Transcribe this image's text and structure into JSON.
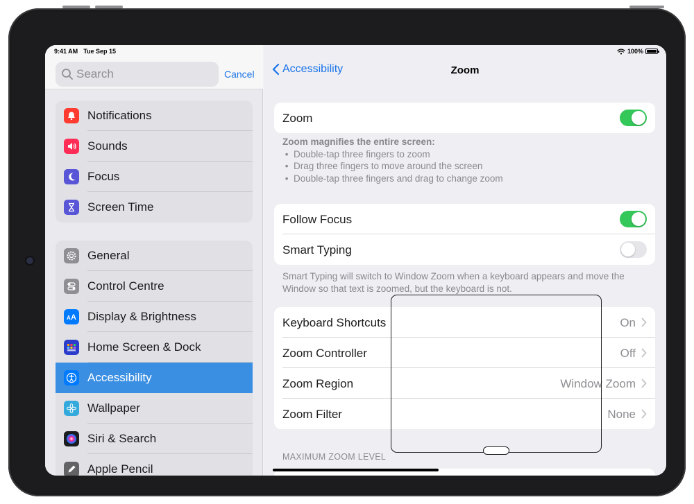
{
  "status": {
    "time": "9:41 AM",
    "date": "Tue Sep 15",
    "battery": "100%"
  },
  "search": {
    "placeholder": "Search",
    "cancel": "Cancel"
  },
  "sidebar": {
    "group1": [
      {
        "label": "Notifications",
        "icon": "bell-icon",
        "color": "#ff3b30"
      },
      {
        "label": "Sounds",
        "icon": "speaker-icon",
        "color": "#ff2d55"
      },
      {
        "label": "Focus",
        "icon": "moon-icon",
        "color": "#5856d6"
      },
      {
        "label": "Screen Time",
        "icon": "hourglass-icon",
        "color": "#5856d6"
      }
    ],
    "group2": [
      {
        "label": "General",
        "icon": "gear-icon",
        "color": "#8e8e93"
      },
      {
        "label": "Control Centre",
        "icon": "switches-icon",
        "color": "#8e8e93"
      },
      {
        "label": "Display & Brightness",
        "icon": "text-size-icon",
        "color": "#007aff"
      },
      {
        "label": "Home Screen & Dock",
        "icon": "app-grid-icon",
        "color": "#2c3dcc"
      },
      {
        "label": "Accessibility",
        "icon": "accessibility-icon",
        "color": "#007aff",
        "selected": true
      },
      {
        "label": "Wallpaper",
        "icon": "flower-icon",
        "color": "#34aadc"
      },
      {
        "label": "Siri & Search",
        "icon": "siri-icon",
        "color": "#1c1c1e"
      },
      {
        "label": "Apple Pencil",
        "icon": "pencil-icon",
        "color": "#636366"
      }
    ]
  },
  "nav": {
    "back_label": "Accessibility",
    "title": "Zoom"
  },
  "zoom": {
    "label": "Zoom",
    "enabled": true
  },
  "zoom_desc": {
    "heading": "Zoom magnifies the entire screen:",
    "lines": [
      "Double-tap three fingers to zoom",
      "Drag three fingers to move around the screen",
      "Double-tap three fingers and drag to change zoom"
    ]
  },
  "follow_focus": {
    "label": "Follow Focus",
    "enabled": true
  },
  "smart_typing": {
    "label": "Smart Typing",
    "enabled": false
  },
  "smart_typing_desc": "Smart Typing will switch to Window Zoom when a keyboard appears and move the Window so that text is zoomed, but the keyboard is not.",
  "options": [
    {
      "label": "Keyboard Shortcuts",
      "value": "On"
    },
    {
      "label": "Zoom Controller",
      "value": "Off"
    },
    {
      "label": "Zoom Region",
      "value": "Window Zoom"
    },
    {
      "label": "Zoom Filter",
      "value": "None"
    }
  ],
  "max_zoom_section": "MAXIMUM ZOOM LEVEL"
}
